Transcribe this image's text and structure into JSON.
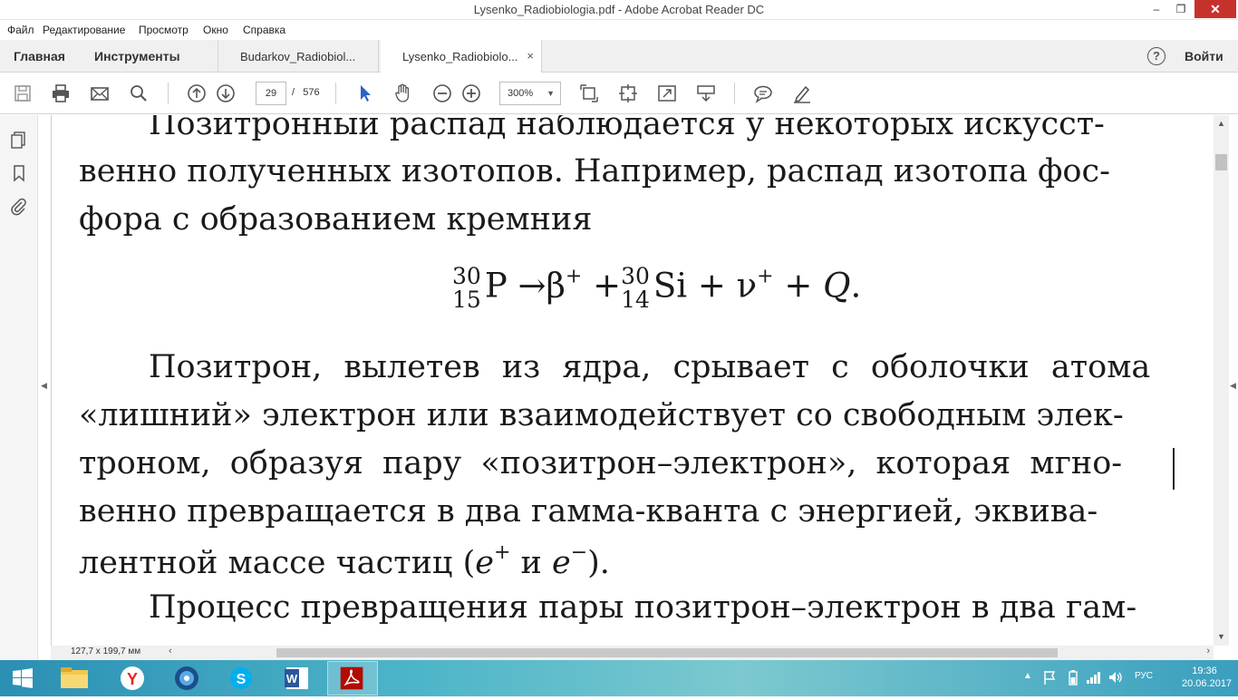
{
  "window": {
    "title": "Lysenko_Radiobiologia.pdf - Adobe Acrobat Reader DC",
    "minimize": "–",
    "maximize": "❐",
    "close": "✕"
  },
  "menu": [
    "Файл",
    "Редактирование",
    "Просмотр",
    "Окно",
    "Справка"
  ],
  "tabs": {
    "home": "Главная",
    "tools": "Инструменты",
    "docs": [
      {
        "label": "Budarkov_Radiobiol...",
        "active": false
      },
      {
        "label": "Lysenko_Radiobiolo...",
        "active": true,
        "close": "×"
      }
    ],
    "help": "?",
    "signin": "Войти"
  },
  "toolbar": {
    "page_current": "29",
    "page_separator": "/",
    "page_total": "576",
    "zoom": "300%",
    "zoom_dropdown": "▼"
  },
  "document": {
    "lines": [
      "Позитронный распад наблюдается у некоторых искусст-",
      "венно полученных изотопов. Например, распад изотопа фос-",
      "фора с образованием кремния",
      "Позитрон, вылетев из ядра, срывает с оболочки атома",
      "«лишний» электрон или взаимодействует со свободным элек-",
      "троном, образуя пару «позитрон–электрон», которая мгно-",
      "венно превращается в два гамма-кванта с энергией, эквива-",
      "лентной массе частиц",
      "Процесс превращения пары позитрон–электрон в два гам-"
    ],
    "formula": {
      "p_mass": "30",
      "p_charge": "15",
      "p_symbol": "P",
      "arrow": "→",
      "beta": "β",
      "beta_sup": "+",
      "plus1": "+",
      "si_mass": "30",
      "si_charge": "14",
      "si_symbol": "Si",
      "plus2": "+",
      "nu": "ν",
      "nu_sup": "+",
      "plus3": "+",
      "q": "Q",
      "dot": "."
    },
    "particles": {
      "open": "(",
      "e1": "e",
      "e1_sup": "+",
      "and": " и ",
      "e2": "e",
      "e2_sup": "−",
      "close": ")."
    }
  },
  "status": {
    "page_size": "127,7 x 199,7 мм"
  },
  "taskbar": {
    "language": "РУС",
    "time": "19:36",
    "date": "20.06.2017"
  }
}
